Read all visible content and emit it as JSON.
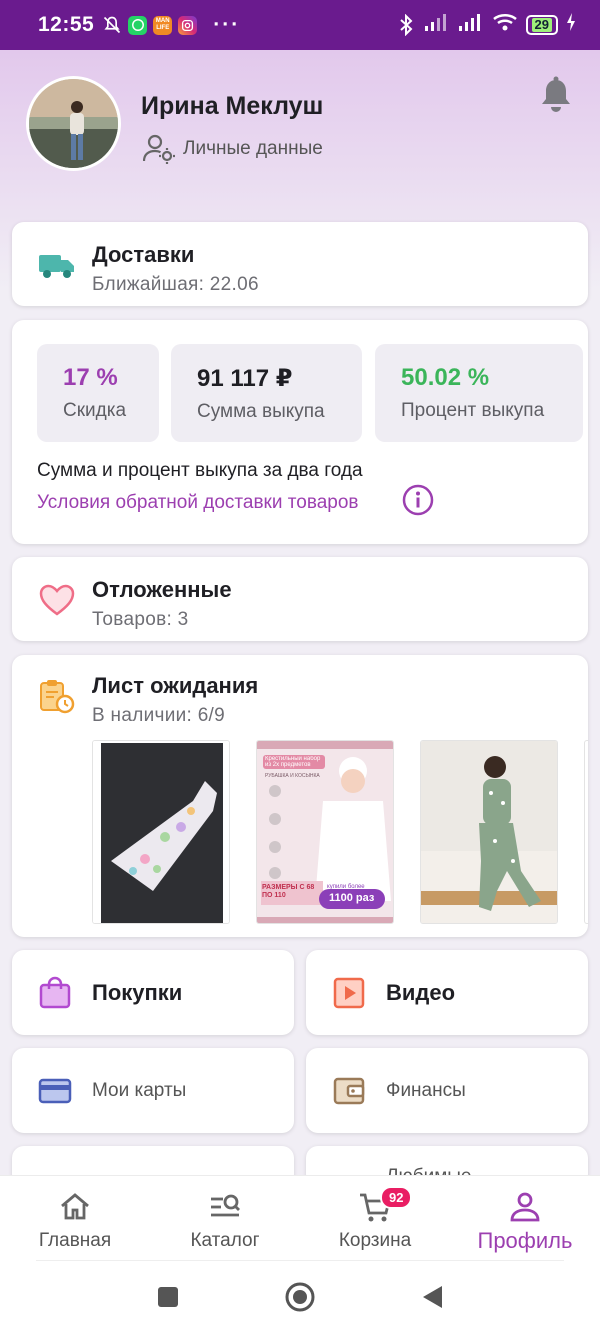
{
  "status_bar": {
    "time": "12:55",
    "app_badge": "MAN LIFE",
    "more": "···",
    "battery": "29"
  },
  "profile": {
    "name": "Ирина Меклуш",
    "personal_data": "Личные данные"
  },
  "delivery": {
    "title": "Доставки",
    "subtitle": "Ближайшая: 22.06"
  },
  "stats": {
    "discount": {
      "value": "17 %",
      "label": "Скидка",
      "color": "#9c3fb0"
    },
    "purchase_sum": {
      "value": "91 117 ₽",
      "label": "Сумма выкупа"
    },
    "purchase_percent": {
      "value": "50.02 %",
      "label": "Процент выкупа",
      "color": "#3bb55a"
    },
    "note": "Сумма и процент выкупа за два года",
    "link": "Условия обратной доставки товаров"
  },
  "deferred": {
    "title": "Отложенные",
    "subtitle": "Товаров: 3"
  },
  "waitlist": {
    "title": "Лист ожидания",
    "subtitle": "В наличии: 6/9",
    "product2": {
      "banner": "Крестильный набор из 2х предметов",
      "caption": "РУБАШКА И КОСЫНКА",
      "sizes": "РАЗМЕРЫ С 68 ПО 110",
      "bought": "купили более",
      "count": "1100 раз"
    }
  },
  "tiles": {
    "purchases": "Покупки",
    "video": "Видео",
    "cards": "Мои карты",
    "finance": "Финансы",
    "favorites_partial": "Любимые"
  },
  "nav": {
    "home": "Главная",
    "catalog": "Каталог",
    "cart": "Корзина",
    "cart_badge": "92",
    "profile": "Профиль"
  },
  "colors": {
    "accent": "#9c3fb0",
    "status_bar": "#6a1b8e",
    "badge": "#e91e63"
  }
}
